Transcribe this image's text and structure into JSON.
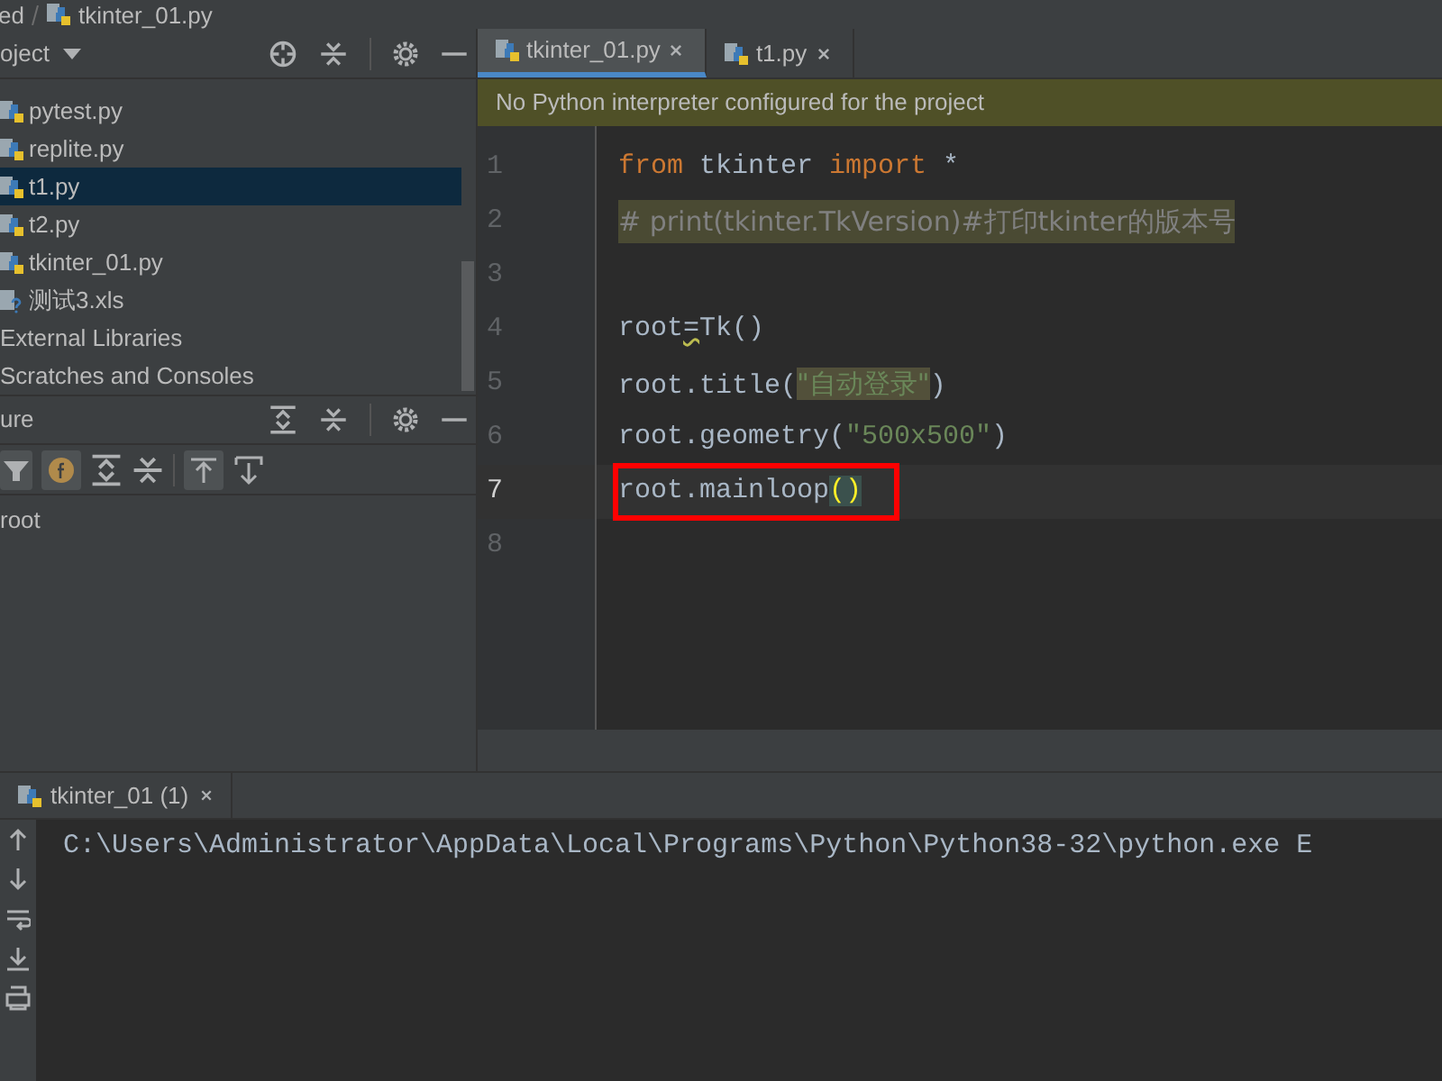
{
  "breadcrumb": [
    "ed",
    "tkinter_01.py"
  ],
  "project_panel": {
    "title": "oject",
    "items": [
      {
        "label": "pytest.py",
        "kind": "python",
        "selected": false
      },
      {
        "label": "replite.py",
        "kind": "python",
        "selected": false
      },
      {
        "label": "t1.py",
        "kind": "python",
        "selected": true
      },
      {
        "label": "t2.py",
        "kind": "python",
        "selected": false
      },
      {
        "label": "tkinter_01.py",
        "kind": "python",
        "selected": false
      },
      {
        "label": "测试3.xls",
        "kind": "unknown",
        "selected": false
      },
      {
        "label": "External Libraries",
        "kind": "group",
        "selected": false
      },
      {
        "label": "Scratches and Consoles",
        "kind": "group",
        "selected": false
      }
    ]
  },
  "structure_panel": {
    "title": "ure",
    "items": [
      "root"
    ]
  },
  "editor_tabs": [
    {
      "label": "tkinter_01.py",
      "selected": true
    },
    {
      "label": "t1.py",
      "selected": false
    }
  ],
  "banner": "No Python interpreter configured for the project",
  "code_lines": [
    {
      "number": "1",
      "highlighted": false,
      "current": false,
      "boxed": false,
      "tokens": [
        {
          "kind": "keyword",
          "text": "from"
        },
        {
          "kind": "plain",
          "text": " tkinter "
        },
        {
          "kind": "keyword",
          "text": "import"
        },
        {
          "kind": "plain",
          "text": " *"
        }
      ]
    },
    {
      "number": "2",
      "highlighted": true,
      "current": false,
      "boxed": false,
      "tokens": [
        {
          "kind": "comment",
          "text": "# print(tkinter.TkVersion)#打印tkinter的版本号"
        }
      ]
    },
    {
      "number": "3",
      "current": false
    },
    {
      "number": "4",
      "highlighted": false,
      "current": false,
      "boxed": false,
      "tokens": [
        {
          "kind": "plain",
          "text": "root"
        },
        {
          "kind": "warning",
          "text": "="
        },
        {
          "kind": "plain",
          "text": "Tk()"
        }
      ]
    },
    {
      "number": "5",
      "highlighted": false,
      "current": false,
      "boxed": false,
      "tokens": [
        {
          "kind": "plain",
          "text": "root.title("
        },
        {
          "kind": "string_marked",
          "text": "\"自动登录\""
        },
        {
          "kind": "plain",
          "text": ")"
        }
      ]
    },
    {
      "number": "6",
      "highlighted": false,
      "current": false,
      "boxed": false,
      "tokens": [
        {
          "kind": "plain",
          "text": "root.geometry("
        },
        {
          "kind": "string",
          "text": "\"500x500\""
        },
        {
          "kind": "plain",
          "text": ")"
        }
      ]
    },
    {
      "number": "7",
      "highlighted": false,
      "current": true,
      "boxed": true,
      "tokens": [
        {
          "kind": "plain",
          "text": "root.mainloop"
        },
        {
          "kind": "brace_match",
          "text": "()"
        }
      ]
    },
    {
      "number": "8",
      "current": false
    }
  ],
  "run_tab": {
    "label": "tkinter_01 (1)"
  },
  "console_lines": [
    "C:\\Users\\Administrator\\AppData\\Local\\Programs\\Python\\Python38-32\\python.exe E"
  ]
}
